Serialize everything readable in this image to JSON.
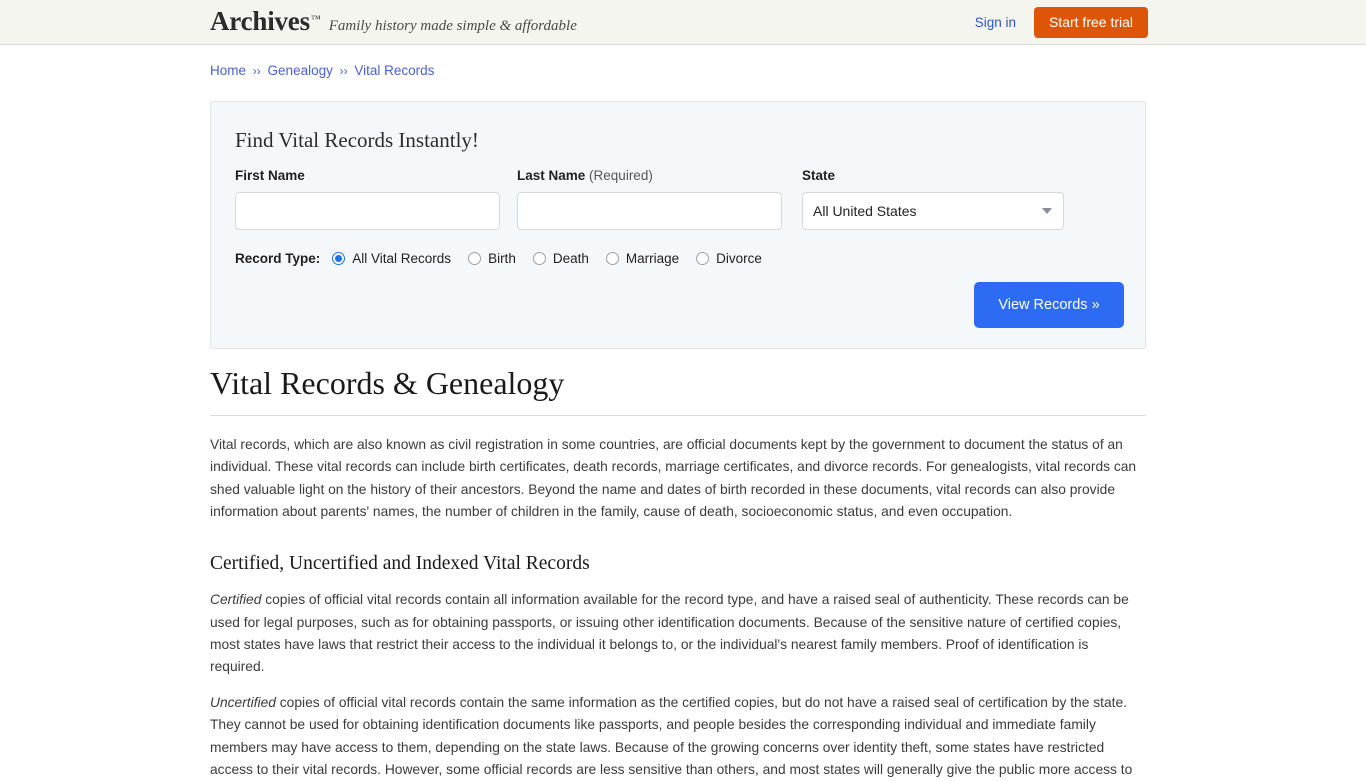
{
  "header": {
    "brand_name": "Archives",
    "brand_tm": "™",
    "tagline": "Family history made simple & affordable",
    "signin_label": "Sign in",
    "trial_label": "Start free trial",
    "accent_orange": "#dd5608",
    "link_blue": "#2b57c9"
  },
  "breadcrumb": {
    "items": [
      {
        "label": "Home"
      },
      {
        "label": "Genealogy"
      },
      {
        "label": "Vital Records"
      }
    ],
    "separator": "››"
  },
  "search_panel": {
    "title": "Find Vital Records Instantly!",
    "first_name": {
      "label": "First Name",
      "value": "",
      "placeholder": ""
    },
    "last_name": {
      "label": "Last Name",
      "required_note": "(Required)",
      "value": "",
      "placeholder": ""
    },
    "state": {
      "label": "State",
      "selected": "All United States",
      "caret_icon": "chevron-down-icon"
    },
    "record_type": {
      "label": "Record Type:",
      "options": [
        {
          "label": "All Vital Records",
          "checked": true
        },
        {
          "label": "Birth",
          "checked": false
        },
        {
          "label": "Death",
          "checked": false
        },
        {
          "label": "Marriage",
          "checked": false
        },
        {
          "label": "Divorce",
          "checked": false
        }
      ]
    },
    "submit_label": "View Records »",
    "submit_color": "#2d6bf5"
  },
  "article": {
    "heading": "Vital Records & Genealogy",
    "intro": "Vital records, which are also known as civil registration in some countries, are official documents kept by the government to document the status of an individual. These vital records can include birth certificates, death records, marriage certificates, and divorce records. For genealogists, vital records can shed valuable light on the history of their ancestors. Beyond the name and dates of birth recorded in these documents, vital records can also provide information about parents' names, the number of children in the family, cause of death, socioeconomic status, and even occupation.",
    "section_heading": "Certified, Uncertified and Indexed Vital Records",
    "certified_lead": "Certified",
    "certified_body": " copies of official vital records contain all information available for the record type, and have a raised seal of authenticity. These records can be used for legal purposes, such as for obtaining passports, or issuing other identification documents. Because of the sensitive nature of certified copies, most states have laws that restrict their access to the individual it belongs to, or the individual's nearest family members. Proof of identification is required.",
    "uncertified_lead": "Uncertified",
    "uncertified_body": " copies of official vital records contain the same information as the certified copies, but do not have a raised seal of certification by the state. They cannot be used for obtaining identification documents like passports, and people besides the corresponding individual and immediate family members may have access to them, depending on the state laws. Because of the growing concerns over identity theft, some states have restricted access to their vital records. However, some official records are less sensitive than others, and most states will generally give the public more access to"
  }
}
